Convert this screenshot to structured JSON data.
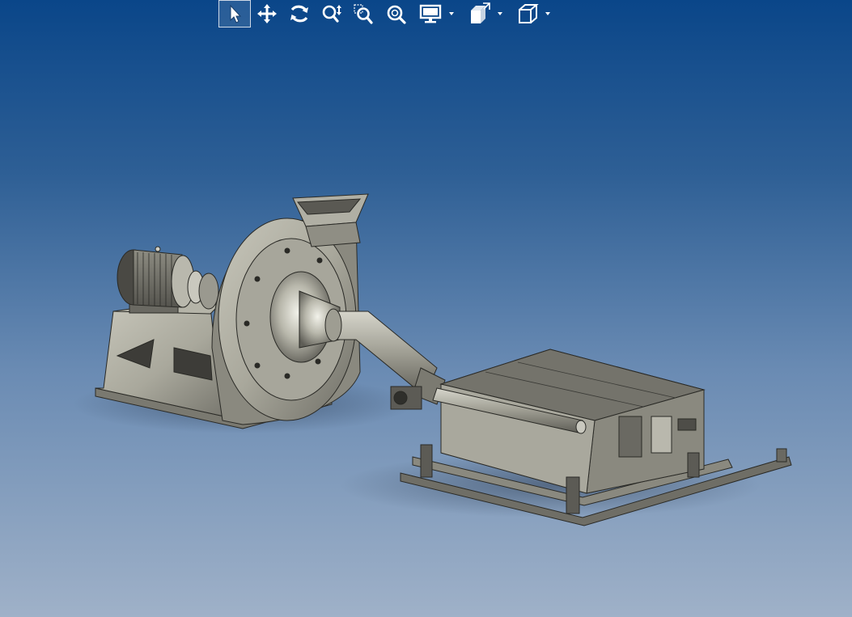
{
  "window": {
    "background_top": "#0a4689",
    "background_bottom": "#9fb1c8"
  },
  "toolbar": {
    "items": [
      {
        "name": "select-tool",
        "icon": "pointer-arrow-icon",
        "active": true
      },
      {
        "name": "pan-tool",
        "icon": "four-way-arrow-icon",
        "active": false
      },
      {
        "name": "rotate-tool",
        "icon": "rotate-arrows-icon",
        "active": false
      },
      {
        "name": "zoom-up-down-tool",
        "icon": "zoom-updown-icon",
        "active": false
      },
      {
        "name": "zoom-area-tool",
        "icon": "zoom-window-icon",
        "active": false
      },
      {
        "name": "zoom-fit-tool",
        "icon": "zoom-fit-icon",
        "active": false
      },
      {
        "name": "display-mode-menu",
        "icon": "monitor-icon",
        "has_menu": true
      },
      {
        "name": "view-orientation-menu",
        "icon": "view-cube-flip-icon",
        "has_menu": true
      },
      {
        "name": "standard-views-menu",
        "icon": "cube-icon",
        "has_menu": true
      }
    ]
  },
  "model": {
    "description_icon": "cad-assembly-fan-conveyor"
  }
}
